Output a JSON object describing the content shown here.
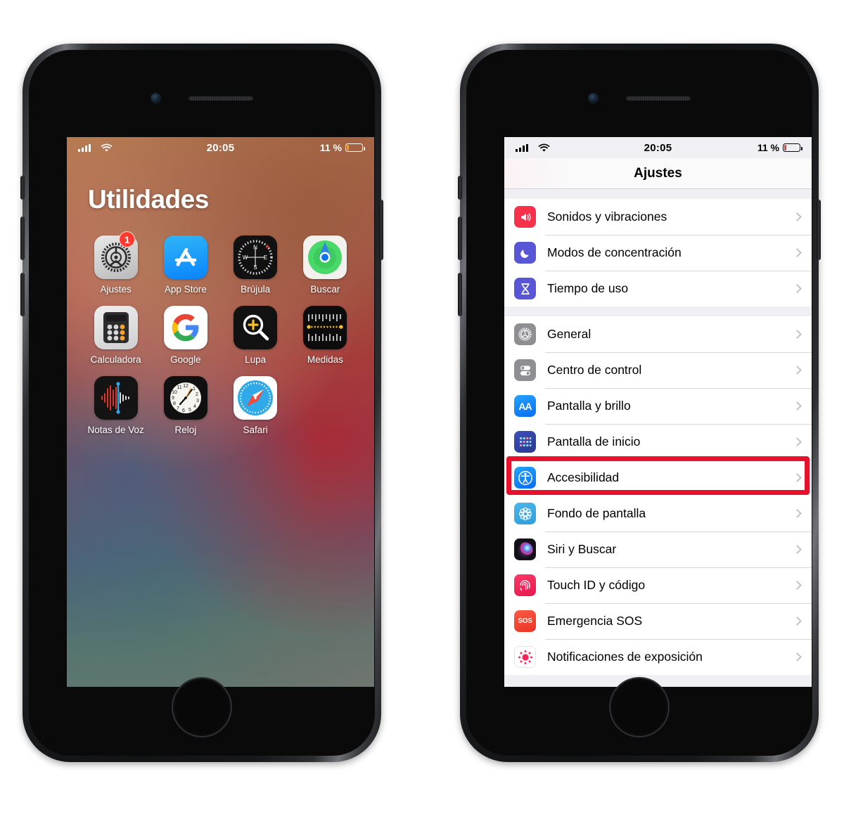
{
  "statusbar": {
    "time": "20:05",
    "battery_percent": "11 %",
    "signal_icon": "cellular-bars-icon",
    "wifi_icon": "wifi-icon",
    "battery_icon": "battery-low-icon",
    "battery_level": 11
  },
  "home": {
    "folder_title": "Utilidades",
    "apps": [
      {
        "label": "Ajustes",
        "icon": "settings-gear-icon",
        "badge": "1"
      },
      {
        "label": "App Store",
        "icon": "app-store-icon",
        "badge": null
      },
      {
        "label": "Brújula",
        "icon": "compass-icon",
        "badge": null
      },
      {
        "label": "Buscar",
        "icon": "find-my-icon",
        "badge": null
      },
      {
        "label": "Calculadora",
        "icon": "calculator-icon",
        "badge": null
      },
      {
        "label": "Google",
        "icon": "google-icon",
        "badge": null
      },
      {
        "label": "Lupa",
        "icon": "magnifier-icon",
        "badge": null
      },
      {
        "label": "Medidas",
        "icon": "measure-ruler-icon",
        "badge": null
      },
      {
        "label": "Notas de Voz",
        "icon": "voice-memos-icon",
        "badge": null
      },
      {
        "label": "Reloj",
        "icon": "clock-icon",
        "badge": null
      },
      {
        "label": "Safari",
        "icon": "safari-compass-icon",
        "badge": null
      }
    ]
  },
  "settings": {
    "title": "Ajustes",
    "groups": [
      {
        "rows": [
          {
            "label": "Sonidos y vibraciones",
            "icon": "speaker-waves-icon",
            "color": "#f8314a",
            "highlighted": false
          },
          {
            "label": "Modos de concentración",
            "icon": "moon-icon",
            "color": "#5856d6",
            "highlighted": false
          },
          {
            "label": "Tiempo de uso",
            "icon": "hourglass-icon",
            "color": "#5856d6",
            "highlighted": false
          }
        ]
      },
      {
        "rows": [
          {
            "label": "General",
            "icon": "gear-icon",
            "color": "#8e8e93",
            "highlighted": false
          },
          {
            "label": "Centro de control",
            "icon": "toggles-icon",
            "color": "#8e8e93",
            "highlighted": false
          },
          {
            "label": "Pantalla y brillo",
            "icon": "aa-text-icon",
            "color": "#007aff",
            "highlighted": false
          },
          {
            "label": "Pantalla de inicio",
            "icon": "home-grid-icon",
            "color": "#3a5bd9",
            "highlighted": false
          },
          {
            "label": "Accesibilidad",
            "icon": "accessibility-icon",
            "color": "#007aff",
            "highlighted": true
          },
          {
            "label": "Fondo de pantalla",
            "icon": "wallpaper-flower-icon",
            "color": "#3aa0dd",
            "highlighted": false
          },
          {
            "label": "Siri y Buscar",
            "icon": "siri-orb-icon",
            "color": "#1a1a2e",
            "highlighted": false
          },
          {
            "label": "Touch ID y código",
            "icon": "fingerprint-icon",
            "color": "#f5325b",
            "highlighted": false
          },
          {
            "label": "Emergencia SOS",
            "icon": "sos-icon",
            "color": "#f5463c",
            "highlighted": false
          },
          {
            "label": "Notificaciones de exposición",
            "icon": "exposure-dot-icon",
            "color": "#ffffff",
            "highlighted": false
          }
        ]
      }
    ]
  },
  "colors": {
    "highlight_border": "#e8112d",
    "ios_blue": "#007aff",
    "ios_red": "#ff3b30",
    "settings_bg": "#efeff4"
  }
}
